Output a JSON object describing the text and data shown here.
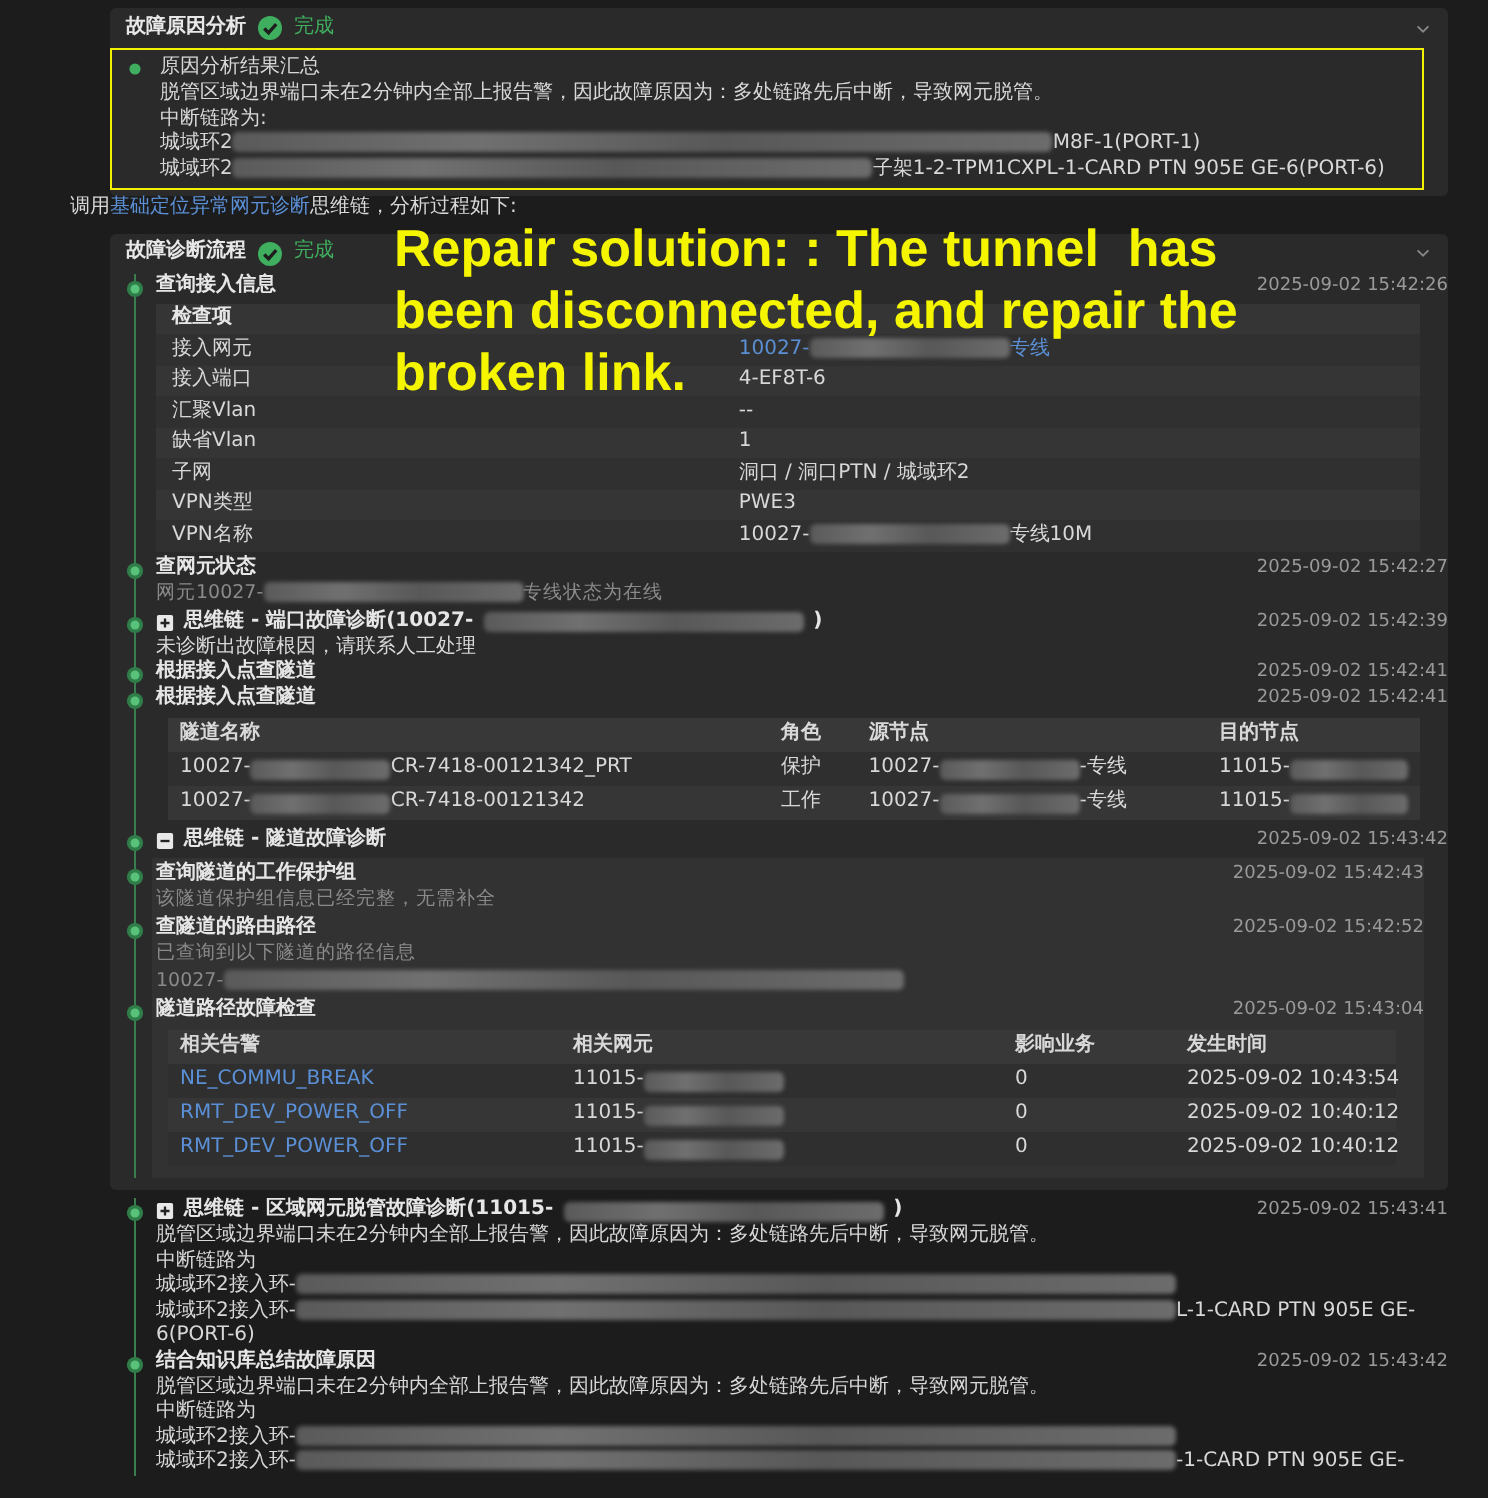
{
  "analysis_panel": {
    "title": "故障原因分析",
    "status": "完成",
    "expanded": true,
    "summary": {
      "title": "原因分析结果汇总",
      "lines": [
        "脱管区域边界端口未在2分钟内全部上报告警，因此故障原因为：多处链路先后中断，导致网元脱管。",
        "中断链路为:",
        {
          "prefix": "城域环2",
          "suffix": "M8F-1(PORT-1)"
        },
        {
          "prefix": "城域环2",
          "suffix": "子架1-2-TPM1CXPL-1-CARD PTN 905E GE-6(PORT-6)"
        }
      ]
    }
  },
  "invoke_line": {
    "before": "调用",
    "link": "基础定位异常网元诊断",
    "after": "思维链，分析过程如下:"
  },
  "diagnosis_panel": {
    "title": "故障诊断流程",
    "status": "完成",
    "expanded": true,
    "steps": [
      {
        "kind": "kv",
        "title": "查询接入信息",
        "time": "2025-09-02 15:42:26",
        "header": "检查项",
        "rows": [
          {
            "label": "接入网元",
            "value": {
              "prefix": "10027-",
              "suffix": "专线"
            },
            "link": true
          },
          {
            "label": "接入端口",
            "value": "4-EF8T-6",
            "link": false
          },
          {
            "label": "汇聚Vlan",
            "value": "--",
            "link": false
          },
          {
            "label": "缺省Vlan",
            "value": "1",
            "link": false
          },
          {
            "label": "子网",
            "value": "洞口 / 洞口PTN / 城域环2",
            "link": false
          },
          {
            "label": "VPN类型",
            "value": "PWE3",
            "link": false
          },
          {
            "label": "VPN名称",
            "value": {
              "prefix": "10027-",
              "suffix": "专线10M"
            },
            "link": false
          }
        ]
      },
      {
        "kind": "note",
        "title": "查网元状态",
        "time": "2025-09-02 15:42:27",
        "lines": [
          {
            "prefix": "网元10027-",
            "suffix": "专线状态为在线"
          }
        ]
      },
      {
        "kind": "chain",
        "title": {
          "prefix": "思维链 - 端口故障诊断(10027-",
          "suffix": ")"
        },
        "expanded": false,
        "time": "2025-09-02 15:42:39",
        "lines": [
          "未诊断出故障根因，请联系人工处理"
        ]
      },
      {
        "kind": "note",
        "title": "根据接入点查隧道",
        "time": "2025-09-02 15:42:41"
      },
      {
        "kind": "table",
        "title": "根据接入点查隧道",
        "time": "2025-09-02 15:42:41",
        "columns": [
          "隧道名称",
          "角色",
          "源节点",
          "目的节点"
        ],
        "rows": [
          [
            {
              "prefix": "10027-",
              "suffix": "CR-7418-00121342_PRT"
            },
            "保护",
            {
              "prefix": "10027-",
              "suffix": "-专线"
            },
            {
              "prefix": "11015-"
            }
          ],
          [
            {
              "prefix": "10027-",
              "suffix": "CR-7418-00121342"
            },
            "工作",
            {
              "prefix": "10027-",
              "suffix": "-专线"
            },
            {
              "prefix": "11015-"
            }
          ]
        ]
      },
      {
        "kind": "group",
        "title": "思维链 - 隧道故障诊断",
        "expanded": true,
        "time": "2025-09-02 15:43:42",
        "children": [
          {
            "kind": "note",
            "title": "查询隧道的工作保护组",
            "time": "2025-09-02 15:42:43",
            "lines": [
              "该隧道保护组信息已经完整，无需补全"
            ]
          },
          {
            "kind": "note",
            "title": "查隧道的路由路径",
            "time": "2025-09-02 15:42:52",
            "lines": [
              "已查询到以下隧道的路径信息",
              {
                "prefix": "10027-"
              }
            ]
          },
          {
            "kind": "table",
            "title": "隧道路径故障检查",
            "time": "2025-09-02 15:43:04",
            "columns": [
              "相关告警",
              "相关网元",
              "影响业务",
              "发生时间"
            ],
            "rows": [
              [
                {
                  "text": "NE_COMMU_BREAK",
                  "link": true
                },
                {
                  "prefix": "11015-"
                },
                "0",
                "2025-09-02 10:43:54"
              ],
              [
                {
                  "text": "RMT_DEV_POWER_OFF",
                  "link": true
                },
                {
                  "prefix": "11015-"
                },
                "0",
                "2025-09-02 10:40:12"
              ],
              [
                {
                  "text": "RMT_DEV_POWER_OFF",
                  "link": true
                },
                {
                  "prefix": "11015-"
                },
                "0",
                "2025-09-02 10:40:12"
              ]
            ]
          }
        ]
      }
    ]
  },
  "followup_steps": [
    {
      "kind": "chain",
      "title": {
        "prefix": "思维链 - 区域网元脱管故障诊断(11015-",
        "suffix": ")"
      },
      "expanded": false,
      "time": "2025-09-02 15:43:41",
      "lines": [
        "脱管区域边界端口未在2分钟内全部上报告警，因此故障原因为：多处链路先后中断，导致网元脱管。",
        "中断链路为",
        {
          "prefix": "城域环2接入环-"
        },
        {
          "prefix": "城域环2接入环-",
          "suffix": "L-1-CARD PTN 905E GE-"
        },
        "6(PORT-6)"
      ]
    },
    {
      "kind": "note",
      "title": "结合知识库总结故障原因",
      "time": "2025-09-02 15:43:42",
      "lines": [
        "脱管区域边界端口未在2分钟内全部上报告警，因此故障原因为：多处链路先后中断，导致网元脱管。",
        "中断链路为",
        {
          "prefix": "城域环2接入环-"
        },
        {
          "prefix": "城域环2接入环-",
          "suffix": "-1-CARD PTN 905E GE-"
        }
      ]
    }
  ],
  "annotation": {
    "lines": [
      "Repair solution: : The tunnel  has",
      "been disconnected, and repair the",
      "broken link."
    ]
  }
}
